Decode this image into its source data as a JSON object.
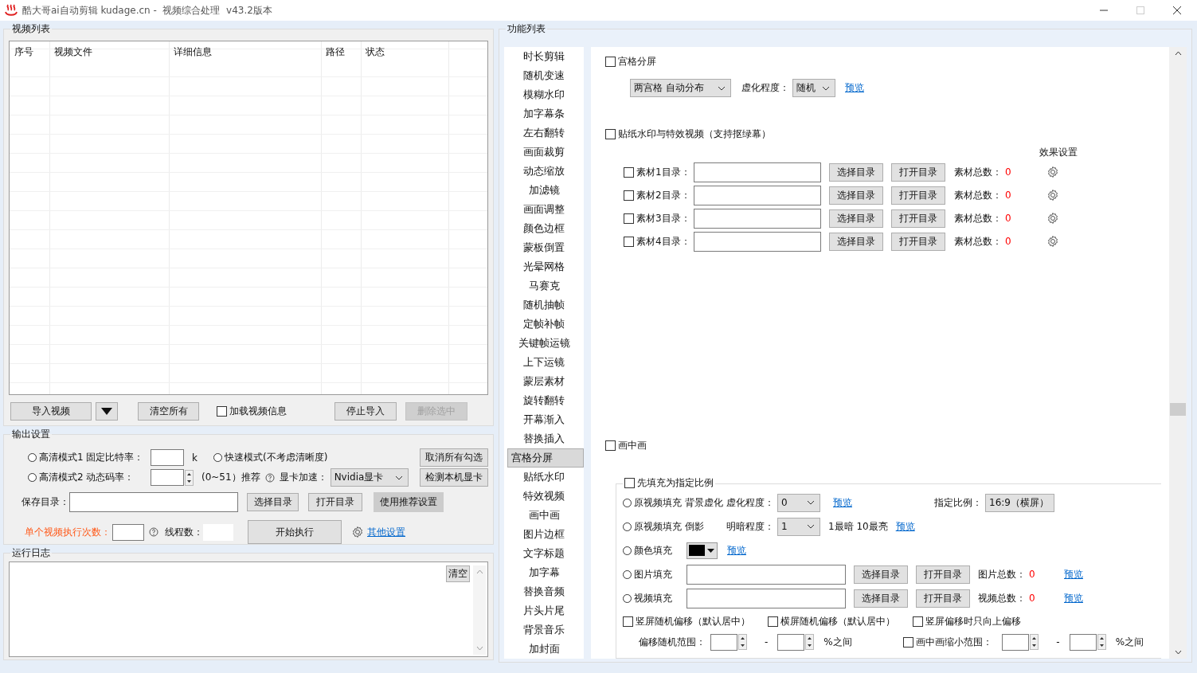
{
  "window": {
    "title": "酷大哥ai自动剪辑 kudage.cn -  视频综合处理  v43.2版本"
  },
  "video_list": {
    "title": "视频列表",
    "columns": [
      "序号",
      "视频文件",
      "详细信息",
      "路径",
      "状态"
    ]
  },
  "list_actions": {
    "import": "导入视频",
    "clear": "清空所有",
    "load_info": {
      "label": "加载视频信息",
      "checked": false
    },
    "stop": "停止导入",
    "delete": {
      "label": "删除选中",
      "disabled": true
    }
  },
  "output": {
    "title": "输出设置",
    "modes": [
      {
        "label": "高清模式1 固定比特率：",
        "selected": false
      },
      {
        "label": "快速模式(不考虑清晰度)",
        "selected": false
      },
      {
        "label": "高清模式2 动态码率：",
        "selected": false
      }
    ],
    "bitrate_unit": "k",
    "crf_hint": "(0~51）推荐",
    "gpu_label": "显卡加速：",
    "gpu": "Nvidia显卡",
    "uncheck_all": "取消所有勾选",
    "detect_gpu": "检测本机显卡",
    "save_dir_label": "保存目录：",
    "choose_dir": "选择目录",
    "open_dir": "打开目录",
    "recommended": "使用推荐设置",
    "runs_label": "单个视频执行次数：",
    "threads_label": "线程数：",
    "start": "开始执行",
    "more": "其他设置"
  },
  "log": {
    "title": "运行日志",
    "clear": "清空"
  },
  "functions": {
    "title": "功能列表",
    "items": [
      {
        "label": "时长剪辑",
        "selected": false
      },
      {
        "label": "随机变速",
        "selected": false
      },
      {
        "label": "模糊水印",
        "selected": false
      },
      {
        "label": "加字幕条",
        "selected": false
      },
      {
        "label": "左右翻转",
        "selected": false
      },
      {
        "label": "画面裁剪",
        "selected": false
      },
      {
        "label": "动态缩放",
        "selected": false
      },
      {
        "label": "加滤镜",
        "selected": false
      },
      {
        "label": "画面调整",
        "selected": false
      },
      {
        "label": "颜色边框",
        "selected": false
      },
      {
        "label": "蒙板倒置",
        "selected": false
      },
      {
        "label": "光晕网格",
        "selected": false
      },
      {
        "label": "马赛克",
        "selected": false
      },
      {
        "label": "随机抽帧",
        "selected": false
      },
      {
        "label": "定帧补帧",
        "selected": false
      },
      {
        "label": "关键帧运镜",
        "selected": false
      },
      {
        "label": "上下运镜",
        "selected": false
      },
      {
        "label": "蒙层素材",
        "selected": false
      },
      {
        "label": "旋转翻转",
        "selected": false
      },
      {
        "label": "开幕渐入",
        "selected": false
      },
      {
        "label": "替换插入",
        "selected": false
      },
      {
        "label": "宫格分屏",
        "selected": true
      },
      {
        "label": "贴纸水印",
        "selected": false
      },
      {
        "label": "特效视频",
        "selected": false
      },
      {
        "label": "画中画",
        "selected": false
      },
      {
        "label": "图片边框",
        "selected": false
      },
      {
        "label": "文字标题",
        "selected": false
      },
      {
        "label": "加字幕",
        "selected": false
      },
      {
        "label": "替换音频",
        "selected": false
      },
      {
        "label": "片头片尾",
        "selected": false
      },
      {
        "label": "背景音乐",
        "selected": false
      },
      {
        "label": "加封面",
        "selected": false
      }
    ]
  },
  "grid_split": {
    "label": "宫格分屏",
    "checked": false,
    "layout": "两宫格 自动分布",
    "blur_label": "虚化程度：",
    "blur": "随机",
    "preview": "预览"
  },
  "sticker": {
    "label": "贴纸水印与特效视频（支持抠绿幕）",
    "checked": false,
    "effects_header": "效果设置",
    "materials": [
      {
        "label": "素材1目录：",
        "checked": false,
        "choose": "选择目录",
        "open": "打开目录",
        "total_label": "素材总数：",
        "total": "0"
      },
      {
        "label": "素材2目录：",
        "checked": false,
        "choose": "选择目录",
        "open": "打开目录",
        "total_label": "素材总数：",
        "total": "0"
      },
      {
        "label": "素材3目录：",
        "checked": false,
        "choose": "选择目录",
        "open": "打开目录",
        "total_label": "素材总数：",
        "total": "0"
      },
      {
        "label": "素材4目录：",
        "checked": false,
        "choose": "选择目录",
        "open": "打开目录",
        "total_label": "素材总数：",
        "total": "0"
      }
    ]
  },
  "pip": {
    "label": "画中画",
    "checked": false,
    "fill_first": {
      "label": "先填充为指定比例",
      "checked": false
    },
    "ratio_label": "指定比例：",
    "ratio": "16:9（横屏）",
    "fills": [
      {
        "kind": "option",
        "label": "原视频填充 背景虚化",
        "selected": false,
        "option_label": "虚化程度：",
        "option": "0",
        "preview": "预览"
      },
      {
        "kind": "option",
        "label": "原视频填充 倒影",
        "selected": false,
        "option_label": "明暗程度：",
        "option": "1",
        "note": "1最暗 10最亮",
        "preview": "预览"
      },
      {
        "kind": "color",
        "label": "颜色填充",
        "selected": false,
        "color": "#000000",
        "preview": "预览"
      },
      {
        "kind": "folder",
        "label": "图片填充",
        "selected": false,
        "choose": "选择目录",
        "open": "打开目录",
        "total_label": "图片总数：",
        "total": "0",
        "preview": "预览"
      },
      {
        "kind": "folder",
        "label": "视频填充",
        "selected": false,
        "choose": "选择目录",
        "open": "打开目录",
        "total_label": "视频总数：",
        "total": "0",
        "preview": "预览"
      }
    ],
    "offsets": [
      {
        "label": "竖屏随机偏移（默认居中）",
        "checked": false
      },
      {
        "label": "横屏随机偏移（默认居中）",
        "checked": false
      },
      {
        "label": "竖屏偏移时只向上偏移",
        "checked": false
      }
    ],
    "offset_range": {
      "label": "偏移随机范围：",
      "dash": "-",
      "unit": "%之间"
    },
    "shrink_range": {
      "label": "画中画缩小范围：",
      "checked": false,
      "dash": "-",
      "unit": "%之间"
    }
  }
}
